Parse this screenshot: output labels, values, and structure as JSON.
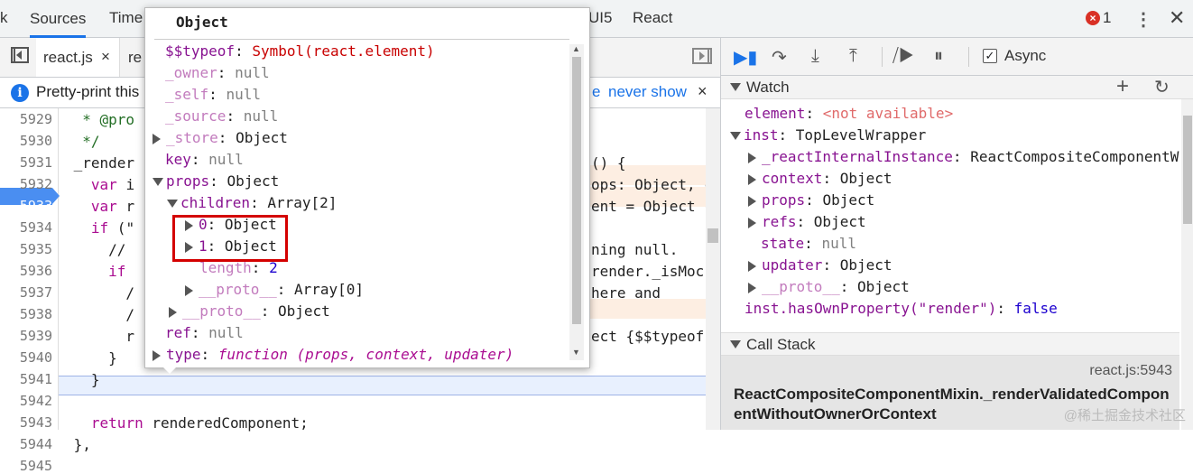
{
  "topbar": {
    "tabs": [
      "k",
      "Sources",
      "Time",
      "UI5",
      "React"
    ],
    "error_count": "1",
    "kebab": "⋮",
    "close": "✕"
  },
  "filetabs": {
    "active_file": "react.js",
    "close": "×",
    "second_file": "re"
  },
  "infobar": {
    "message": "Pretty-print this",
    "e_fragment": "e",
    "never_show": "never show",
    "close": "×"
  },
  "code": {
    "line_numbers": [
      "5929",
      "5930",
      "5931",
      "5932",
      "5933",
      "5934",
      "5935",
      "5936",
      "5937",
      "5938",
      "5939",
      "5940",
      "5941",
      "5942",
      "5943",
      "5944",
      "5945"
    ],
    "breakpoint_line": "5933",
    "left_lines": [
      "  * @pro",
      "  */",
      " _render",
      "   var i",
      "   var r",
      "   if (\"",
      "     //",
      "     if",
      "       /",
      "       /",
      "       r",
      "     }",
      "   }",
      "",
      "   return renderedComponent;",
      " },",
      ""
    ],
    "right_fragments": [
      "() {",
      "ops: Object, c",
      "ent = Object {",
      "",
      "ning null.",
      "render._isMoc",
      "here and",
      "",
      "ect {$$typeof:"
    ]
  },
  "popover": {
    "title": "Object",
    "rows": [
      {
        "key": "$$typeof",
        "sep": ": ",
        "value": "Symbol(react.element)"
      },
      {
        "key": "_owner",
        "sep": ": ",
        "value": "null"
      },
      {
        "key": "_self",
        "sep": ": ",
        "value": "null"
      },
      {
        "key": "_source",
        "sep": ": ",
        "value": "null"
      },
      {
        "key": "_store",
        "sep": ": ",
        "value": "Object"
      },
      {
        "key": "key",
        "sep": ": ",
        "value": "null"
      },
      {
        "key": "props",
        "sep": ": ",
        "value": "Object"
      },
      {
        "key": "children",
        "sep": ": ",
        "value": "Array[2]"
      },
      {
        "key": "0",
        "sep": ": ",
        "value": "Object"
      },
      {
        "key": "1",
        "sep": ": ",
        "value": "Object"
      },
      {
        "key": "length",
        "sep": ": ",
        "value": "2"
      },
      {
        "key": "__proto__",
        "sep": ": ",
        "value": "Array[0]"
      },
      {
        "key": "__proto__",
        "sep": ": ",
        "value": "Object"
      },
      {
        "key": "ref",
        "sep": ": ",
        "value": "null"
      },
      {
        "key": "type",
        "sep": ": ",
        "value": "function (props, context, updater)"
      }
    ]
  },
  "debugger": {
    "async_label": "Async",
    "async_checked": "✓"
  },
  "watch": {
    "title": "Watch",
    "add": "+",
    "refresh": "↻",
    "rows": [
      {
        "key": "element",
        "sep": ": ",
        "value": "<not available>"
      },
      {
        "key": "inst",
        "sep": ": ",
        "value": "TopLevelWrapper"
      },
      {
        "key": "_reactInternalInstance",
        "sep": ": ",
        "value": "ReactCompositeComponentW"
      },
      {
        "key": "context",
        "sep": ": ",
        "value": "Object"
      },
      {
        "key": "props",
        "sep": ": ",
        "value": "Object"
      },
      {
        "key": "refs",
        "sep": ": ",
        "value": "Object"
      },
      {
        "key": "state",
        "sep": ": ",
        "value": "null"
      },
      {
        "key": "updater",
        "sep": ": ",
        "value": "Object"
      },
      {
        "key": "__proto__",
        "sep": ": ",
        "value": "Object"
      },
      {
        "key": "inst.hasOwnProperty(\"render\")",
        "sep": ": ",
        "value": "false"
      }
    ]
  },
  "callstack": {
    "title": "Call Stack",
    "location": "react.js:5943",
    "function_name": "ReactCompositeComponentMixin._renderValidatedComponentWithoutOwnerOrContext"
  },
  "watermark": "@稀土掘金技术社区",
  "colors": {
    "accent": "#1a73e8",
    "highlight_box": "#d40000",
    "breakpoint": "#4a8ef1"
  }
}
